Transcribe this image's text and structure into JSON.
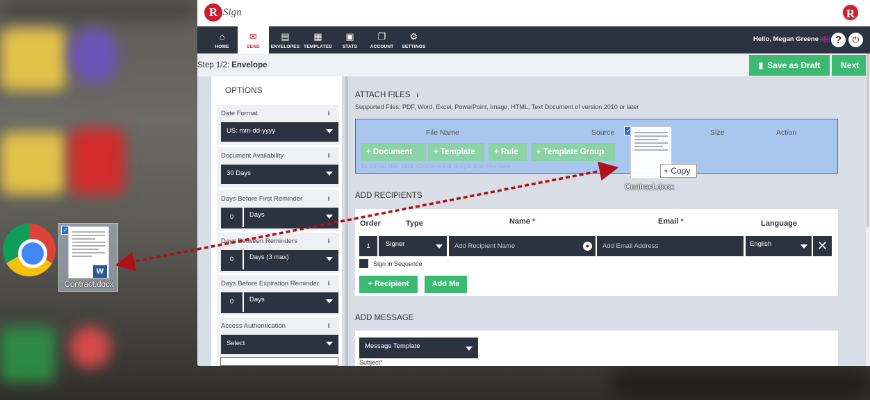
{
  "desktop": {
    "file_name": "Contract.docx"
  },
  "app": {
    "logo_letter": "R",
    "logo_text": "Sign",
    "nav": [
      {
        "label": "HOME",
        "icon": "home-icon"
      },
      {
        "label": "SEND",
        "icon": "envelope-icon"
      },
      {
        "label": "ENVELOPES",
        "icon": "inbox-icon"
      },
      {
        "label": "TEMPLATES",
        "icon": "template-icon"
      },
      {
        "label": "STATS",
        "icon": "briefcase-icon"
      },
      {
        "label": "ACCOUNT",
        "icon": "documents-icon"
      },
      {
        "label": "SETTINGS",
        "icon": "gear-icon"
      }
    ],
    "greeting": "Hello, Megan Greene",
    "step_prefix": "Step 1/2:",
    "step_name": "Envelope",
    "save_draft_label": "Save as Draft",
    "next_label": "Next",
    "options": {
      "title": "OPTIONS",
      "date_format": {
        "label": "Date Format",
        "value": "US: mm-dd-yyyy"
      },
      "doc_availability": {
        "label": "Document Availability",
        "value": "30 Days"
      },
      "first_reminder": {
        "label": "Days Before First Reminder",
        "number": "0",
        "unit": "Days"
      },
      "between_reminders": {
        "label": "Days Between Reminders",
        "number": "0",
        "unit": "Days (3 max)"
      },
      "expiration_reminder": {
        "label": "Days Before Expiration Reminder",
        "number": "0",
        "unit": "Days"
      },
      "access_auth": {
        "label": "Access Authentication",
        "value": "Select"
      }
    },
    "attach": {
      "title": "ATTACH FILES",
      "supported": "Supported Files: PDF, Word, Excel, PowerPoint, Image, HTML, Text Document of version 2010 or later",
      "columns": {
        "file_name": "File Name",
        "source": "Source",
        "size": "Size",
        "action": "Action"
      },
      "buttons": {
        "document": "+ Document",
        "template": "+ Template",
        "rule": "+ Rule",
        "template_group": "+ Template Group"
      },
      "hint": "To upload files, click +Document or drag & drop files here"
    },
    "recipients": {
      "title": "ADD RECIPIENTS",
      "headers": {
        "order": "Order",
        "type": "Type",
        "name": "Name",
        "email": "Email",
        "language": "Language"
      },
      "required_mark": "*",
      "row": {
        "order": "1",
        "type": "Signer",
        "name_placeholder": "Add Recipient Name",
        "email_placeholder": "Add Email Address",
        "language": "English"
      },
      "sign_in_sequence": "Sign in Sequence",
      "add_recipient": "+ Recipient",
      "add_me": "Add Me"
    },
    "message": {
      "title": "ADD MESSAGE",
      "template_value": "Message Template",
      "subject_label": "Subject"
    }
  },
  "drag": {
    "copy_label": "+ Copy",
    "file_name": "Contract.docx"
  }
}
